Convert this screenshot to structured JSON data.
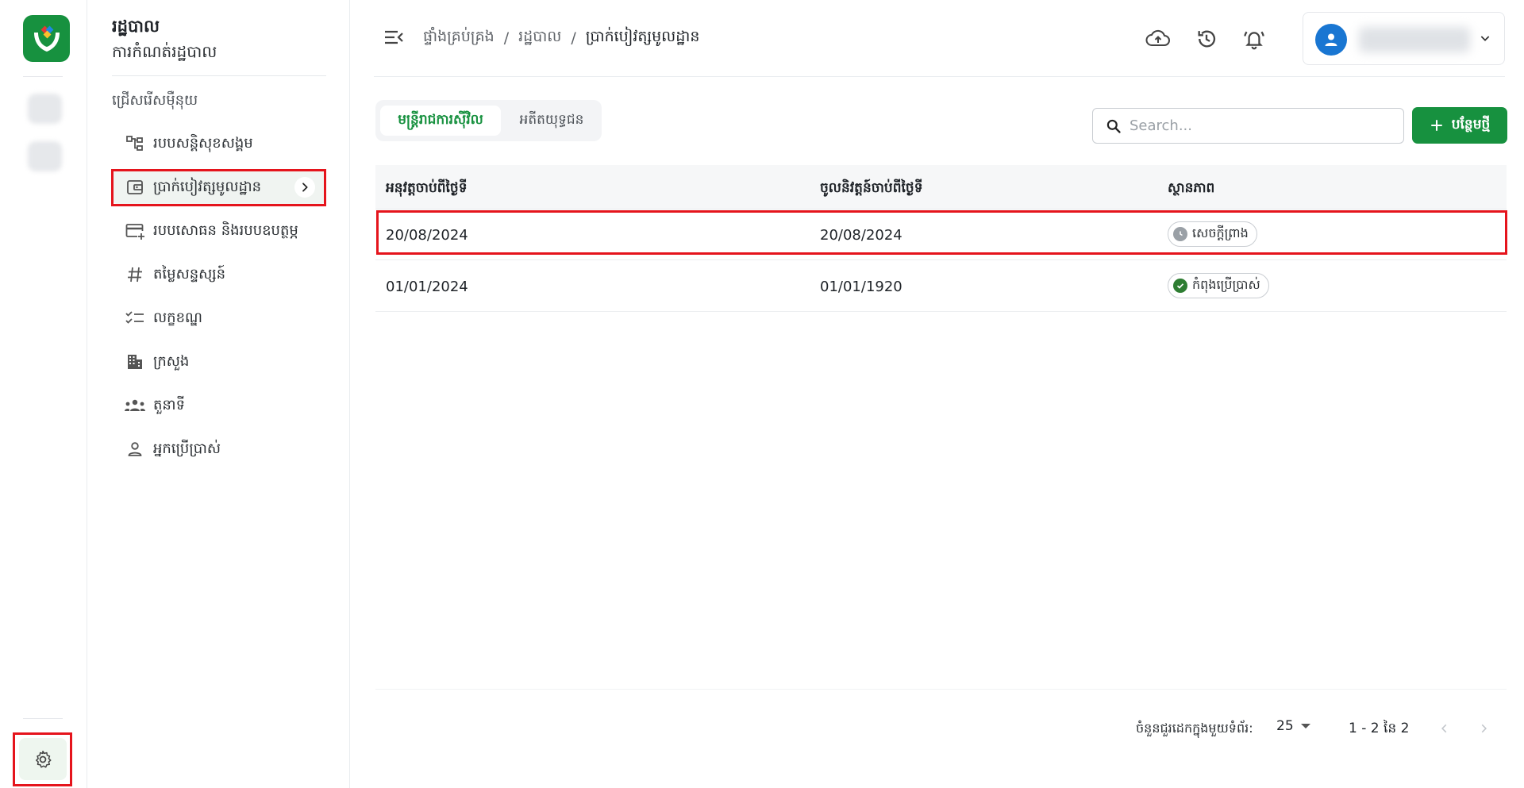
{
  "menu": {
    "title": "រដ្ឋបាល",
    "subtitle": "ការកំណត់រដ្ឋបាល",
    "section_label": "ជ្រើសរើសម៉ឺនុយ",
    "items": [
      {
        "label": "របបសន្តិសុខសង្គម",
        "icon": "hierarchy-icon"
      },
      {
        "label": "ប្រាក់បៀវត្សមូលដ្ឋាន",
        "icon": "wallet-icon"
      },
      {
        "label": "របបសោធន និងរបបឧបត្ថម្ភ",
        "icon": "card-add-icon"
      },
      {
        "label": "តម្លៃសន្ទស្សន៍",
        "icon": "hash-icon"
      },
      {
        "label": "លក្ខខណ្ឌ",
        "icon": "checklist-icon"
      },
      {
        "label": "ក្រសួង",
        "icon": "building-icon"
      },
      {
        "label": "តួនាទី",
        "icon": "group-icon"
      },
      {
        "label": "អ្នកប្រើប្រាស់",
        "icon": "person-icon"
      }
    ]
  },
  "breadcrumb": {
    "items": [
      "ផ្ទាំងគ្រប់គ្រង",
      "រដ្ឋបាល",
      "ប្រាក់បៀវត្សមូលដ្ឋាន"
    ]
  },
  "tabs": [
    {
      "label": "មន្ត្រីរាជការស៊ីវិល",
      "active": true
    },
    {
      "label": "អតីតយុទ្ធជន",
      "active": false
    }
  ],
  "search": {
    "placeholder": "Search..."
  },
  "add_button": {
    "label": "បន្ថែមថ្មី"
  },
  "table": {
    "columns": [
      "អនុវត្តចាប់ពីថ្ងៃទី",
      "ចូលនិវត្តន៍ចាប់ពីថ្ងៃទី",
      "ស្ថានភាព"
    ],
    "rows": [
      {
        "effective_from": "20/08/2024",
        "retire_from": "20/08/2024",
        "status": "សេចក្តីព្រាង",
        "status_kind": "draft"
      },
      {
        "effective_from": "01/01/2024",
        "retire_from": "01/01/1920",
        "status": "កំពុងប្រើប្រាស់",
        "status_kind": "active"
      }
    ]
  },
  "pagination": {
    "rows_per_page_label": "ចំនួនជួរដេកក្នុងមួយទំព័រ:",
    "rows_per_page": "25",
    "range": "1 - 2 នៃ 2"
  },
  "colors": {
    "brand": "#17913f",
    "highlight": "#e5141c",
    "avatar": "#1976d2",
    "active_status": "#2e7d32",
    "draft_status": "#9aa0a6"
  }
}
